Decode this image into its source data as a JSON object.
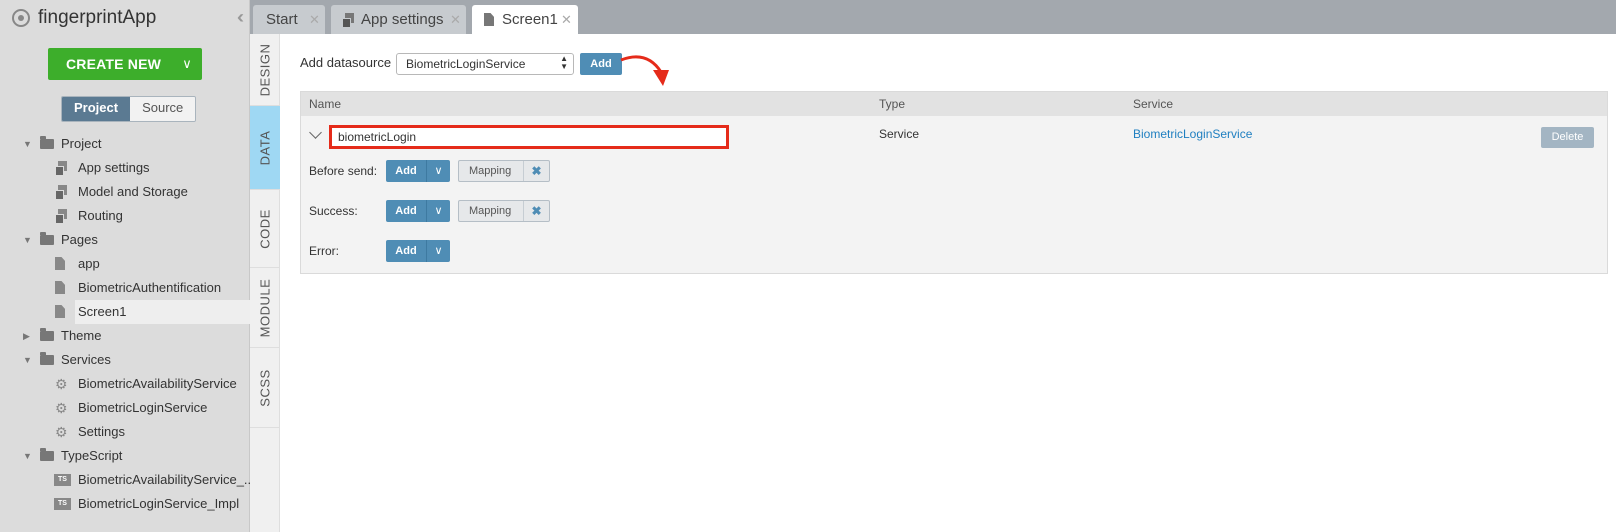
{
  "app": {
    "name": "fingerprintApp"
  },
  "sidebar": {
    "create_new_label": "CREATE NEW",
    "switcher": {
      "project": "Project",
      "source": "Source"
    },
    "tree": [
      {
        "label": "Project",
        "icon": "folder-icon",
        "level": 0,
        "expanded": true
      },
      {
        "label": "App settings",
        "icon": "settings-icon",
        "level": 1
      },
      {
        "label": "Model and Storage",
        "icon": "settings-icon",
        "level": 1
      },
      {
        "label": "Routing",
        "icon": "settings-icon",
        "level": 1
      },
      {
        "label": "Pages",
        "icon": "folder-icon",
        "level": 0,
        "expanded": true
      },
      {
        "label": "app",
        "icon": "page-icon",
        "level": 1
      },
      {
        "label": "BiometricAuthentification",
        "icon": "page-icon",
        "level": 1
      },
      {
        "label": "Screen1",
        "icon": "page-icon",
        "level": 1,
        "selected": true
      },
      {
        "label": "Theme",
        "icon": "folder-icon",
        "level": 0,
        "expanded": false
      },
      {
        "label": "Services",
        "icon": "folder-icon",
        "level": 0,
        "expanded": true
      },
      {
        "label": "BiometricAvailabilityService",
        "icon": "gear-icon",
        "level": 1
      },
      {
        "label": "BiometricLoginService",
        "icon": "gear-icon",
        "level": 1
      },
      {
        "label": "Settings",
        "icon": "gear-icon",
        "level": 1
      },
      {
        "label": "TypeScript",
        "icon": "folder-icon",
        "level": 0,
        "expanded": true
      },
      {
        "label": "BiometricAvailabilityService_...",
        "icon": "ts-icon",
        "level": 1
      },
      {
        "label": "BiometricLoginService_Impl",
        "icon": "ts-icon",
        "level": 1
      }
    ]
  },
  "tabs": [
    {
      "label": "Start",
      "icon": ""
    },
    {
      "label": "App settings",
      "icon": "settings-icon"
    },
    {
      "label": "Screen1",
      "icon": "page-icon",
      "active": true
    }
  ],
  "vtabs": [
    "DESIGN",
    "DATA",
    "CODE",
    "MODULE",
    "SCSS"
  ],
  "datasource": {
    "label": "Add datasource",
    "selected": "BiometricLoginService",
    "add_label": "Add"
  },
  "table": {
    "headers": {
      "name": "Name",
      "type": "Type",
      "service": "Service"
    },
    "row": {
      "name": "biometricLogin",
      "type": "Service",
      "service": "BiometricLoginService",
      "delete_label": "Delete"
    },
    "events": [
      {
        "label": "Before send:",
        "add_label": "Add",
        "mapping": "Mapping"
      },
      {
        "label": "Success:",
        "add_label": "Add",
        "mapping": "Mapping"
      },
      {
        "label": "Error:",
        "add_label": "Add",
        "mapping": ""
      }
    ]
  },
  "colors": {
    "accent": "#4f8db5",
    "create_green": "#3dae2b",
    "highlight_red": "#e52b1a",
    "active_vtab": "#9fd8f3"
  }
}
